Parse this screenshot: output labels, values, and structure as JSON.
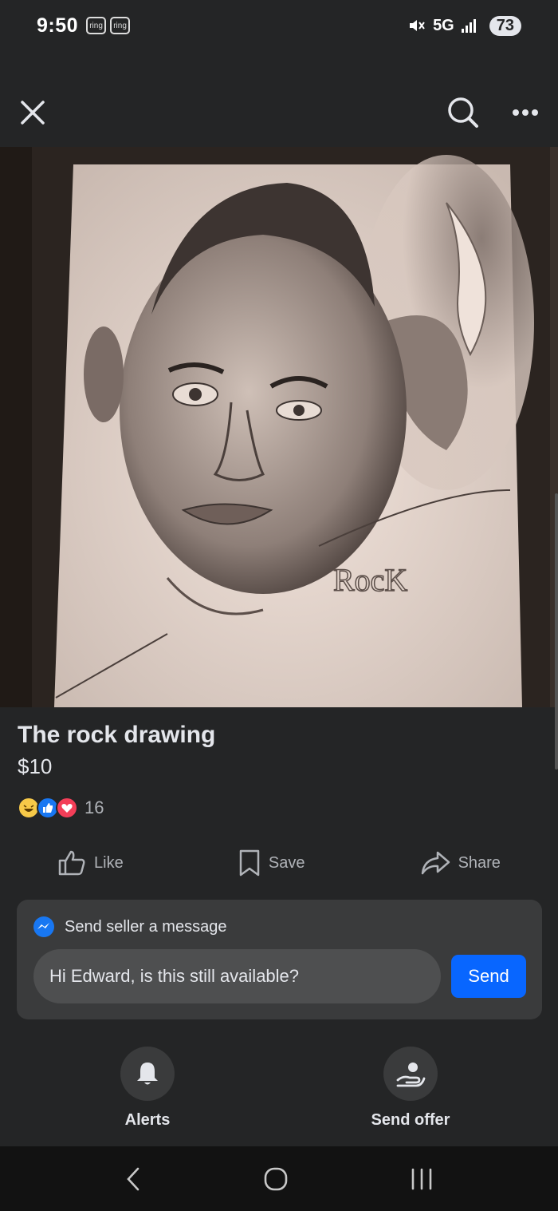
{
  "status_bar": {
    "time": "9:50",
    "badges": [
      "ring",
      "ring"
    ],
    "network": "5G",
    "battery": "73"
  },
  "nav": {
    "close_icon": "close-icon",
    "search_icon": "search-icon",
    "more_icon": "more-icon"
  },
  "listing": {
    "image_text": "RocK",
    "title": "The rock drawing",
    "price": "$10",
    "reaction_count": "16"
  },
  "actions": {
    "like": "Like",
    "save": "Save",
    "share": "Share"
  },
  "message": {
    "header": "Send seller a message",
    "input_value": "Hi Edward, is this still available?",
    "send_label": "Send"
  },
  "bottom": {
    "alerts": "Alerts",
    "send_offer": "Send offer"
  },
  "colors": {
    "background": "#242526",
    "accent": "#0866ff",
    "card": "#3a3b3c"
  }
}
